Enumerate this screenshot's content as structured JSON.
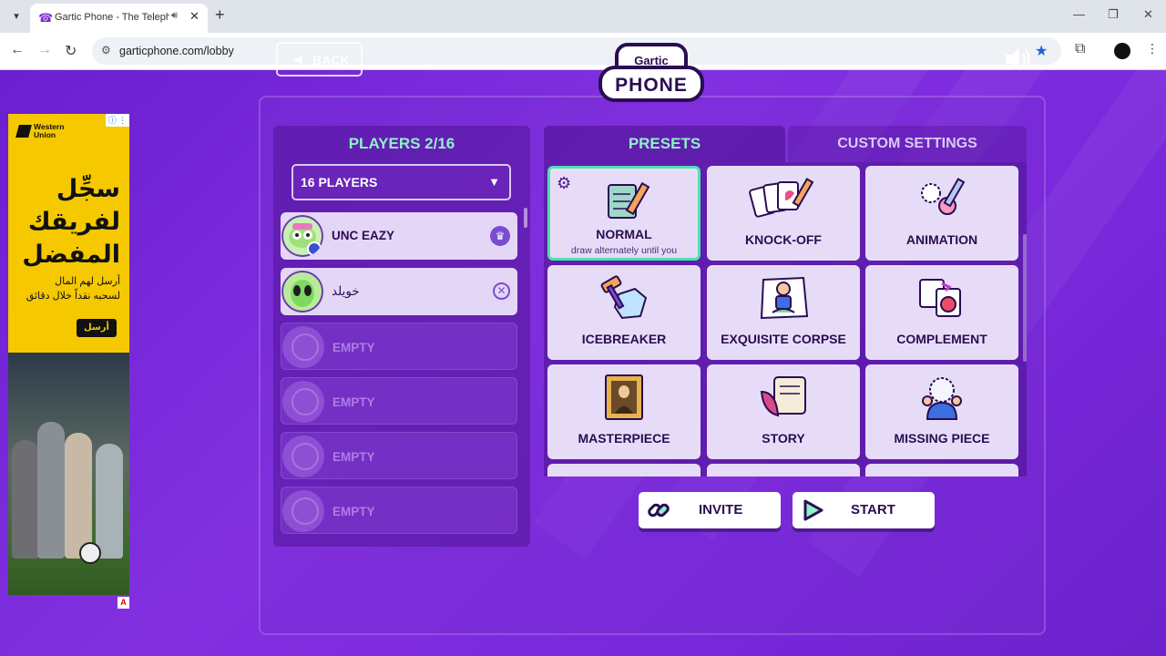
{
  "browser": {
    "tab_title": "Gartic Phone - The Telephone Game",
    "url": "garticphone.com/lobby",
    "icons": {
      "favicon": "phone-icon",
      "audio": "speaker-icon",
      "close": "close-icon",
      "new_tab": "plus-icon"
    }
  },
  "ad": {
    "brand": "Western Union",
    "headline_lines": [
      "سجِّل",
      "لفريقك",
      "المفضل"
    ],
    "subtext_lines": [
      "أرسل لهم المال",
      "لسحبه نقداً خلال دقائق"
    ],
    "cta": "أرسل",
    "badge": "A"
  },
  "header": {
    "back_label": "BACK",
    "logo_top": "Gartic",
    "logo_bottom": "PHONE"
  },
  "players": {
    "title": "PLAYERS 2/16",
    "select_value": "16 PLAYERS",
    "rows": [
      {
        "name": "UNC EAZY",
        "type": "host"
      },
      {
        "name": "خويلد",
        "type": "player"
      },
      {
        "name": "EMPTY",
        "type": "empty"
      },
      {
        "name": "EMPTY",
        "type": "empty"
      },
      {
        "name": "EMPTY",
        "type": "empty"
      },
      {
        "name": "EMPTY",
        "type": "empty"
      }
    ]
  },
  "presets": {
    "tab_presets": "PRESETS",
    "tab_custom": "CUSTOM SETTINGS",
    "selected": "NORMAL",
    "cards": [
      {
        "label": "NORMAL",
        "sub": "draw alternately until you"
      },
      {
        "label": "KNOCK-OFF"
      },
      {
        "label": "ANIMATION"
      },
      {
        "label": "ICEBREAKER"
      },
      {
        "label": "EXQUISITE CORPSE"
      },
      {
        "label": "COMPLEMENT"
      },
      {
        "label": "MASTERPIECE"
      },
      {
        "label": "STORY"
      },
      {
        "label": "MISSING PIECE"
      }
    ]
  },
  "actions": {
    "invite": "INVITE",
    "start": "START"
  },
  "colors": {
    "accent_mint": "#8ef1c8",
    "background_purple": "#7a2ed8",
    "card_bg": "#e7dcf7",
    "text_dark": "#2a0d52"
  }
}
